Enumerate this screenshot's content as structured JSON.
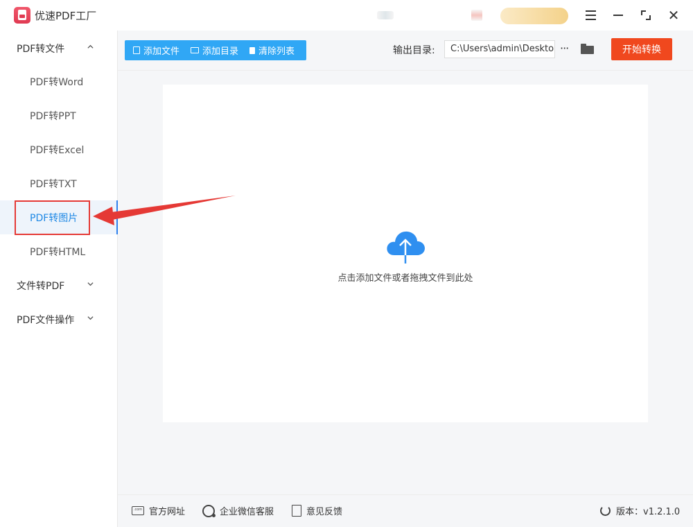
{
  "app": {
    "title": "优速PDF工厂"
  },
  "window_controls": {
    "menu_icon": "hamburger-menu-icon",
    "minimize_icon": "minimize-icon",
    "maximize_icon": "maximize-icon",
    "close_icon": "close-icon",
    "close_glyph": "✕"
  },
  "sidebar": {
    "groups": [
      {
        "label": "PDF转文件",
        "expanded": true
      },
      {
        "label": "文件转PDF",
        "expanded": false
      },
      {
        "label": "PDF文件操作",
        "expanded": false
      }
    ],
    "items": [
      {
        "label": "PDF转Word"
      },
      {
        "label": "PDF转PPT"
      },
      {
        "label": "PDF转Excel"
      },
      {
        "label": "PDF转TXT"
      },
      {
        "label": "PDF转图片",
        "active": true
      },
      {
        "label": "PDF转HTML"
      }
    ]
  },
  "toolbar": {
    "add_file": "添加文件",
    "add_dir": "添加目录",
    "clear_list": "清除列表",
    "output_label": "输出目录:",
    "output_path": "C:\\Users\\admin\\Desktop",
    "more_glyph": "···",
    "start_label": "开始转换"
  },
  "dropzone": {
    "hint": "点击添加文件或者拖拽文件到此处"
  },
  "footer": {
    "website": "官方网址",
    "wechat": "企业微信客服",
    "feedback": "意见反馈",
    "website_icon_text": ".com",
    "version": "版本：v1.2.1.0"
  },
  "colors": {
    "accent_blue": "#30a7f5",
    "start_red": "#f0481e",
    "annotation_red": "#e53935",
    "active_bg": "#eef4fb"
  }
}
